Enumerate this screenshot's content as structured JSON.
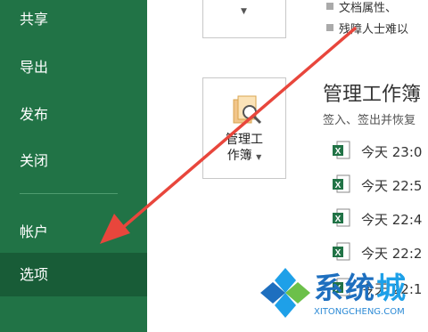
{
  "sidebar": {
    "items": [
      {
        "label": "共享"
      },
      {
        "label": "导出"
      },
      {
        "label": "发布"
      },
      {
        "label": "关闭"
      },
      {
        "label": "帐户"
      },
      {
        "label": "选项"
      }
    ]
  },
  "info": {
    "line1": "文档属性、",
    "line2": "残障人士难以"
  },
  "manage": {
    "button_line1": "管理工",
    "button_line2": "作簿",
    "title": "管理工作簿",
    "subtitle": "签入、签出并恢复",
    "versions": [
      {
        "label": "今天 23:0"
      },
      {
        "label": "今天 22:5"
      },
      {
        "label": "今天 22:4"
      },
      {
        "label": "今天 22:2"
      },
      {
        "label": "今天 22:1"
      }
    ]
  },
  "watermark": {
    "text_main": "系统",
    "text_last": "城",
    "url": "XITONGCHENG.COM"
  },
  "colors": {
    "sidebar_bg": "#217346",
    "sidebar_selected": "#185c37",
    "arrow": "#e8463c"
  }
}
